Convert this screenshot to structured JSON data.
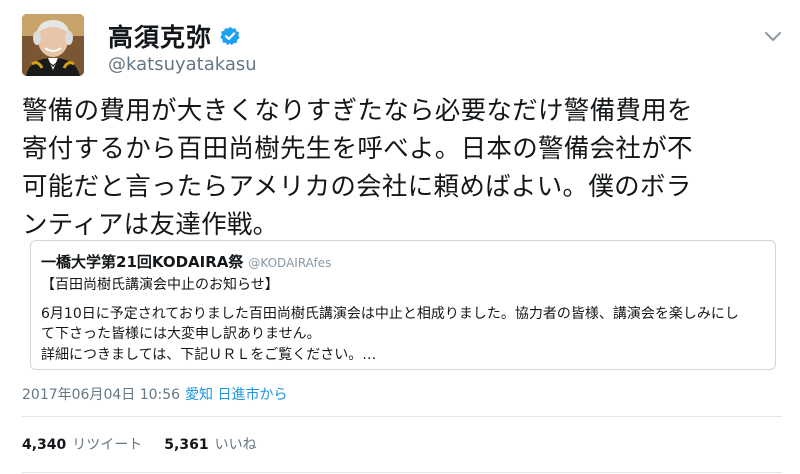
{
  "author": {
    "display_name": "高須克弥",
    "handle": "@katsuyatakasu",
    "verified": true
  },
  "tweet": {
    "lines": [
      "警備の費用が大きくなりすぎたなら必要なだけ警備費用を",
      "寄付するから百田尚樹先生を呼べよ。日本の警備会社が不",
      "可能だと言ったらアメリカの会社に頼めばよい。僕のボラ",
      "ンティアは友達作戦。"
    ]
  },
  "quoted": {
    "name": "一橋大学第21回KODAIRA祭",
    "handle": "@KODAIRAfes",
    "lines": [
      "【百田尚樹氏講演会中止のお知らせ】",
      "6月10日に予定されておりました百田尚樹氏講演会は中止と相成りました。協力者の皆様、講演会を楽しみにし",
      "て下さった皆様には大変申し訳ありません。",
      "詳細につきましては、下記ＵＲＬをご覧ください。…"
    ]
  },
  "meta": {
    "timestamp": "2017年06月04日 10:56",
    "place": "愛知 日進市から"
  },
  "stats": {
    "retweets": "4,340",
    "retweets_label": "リツイート",
    "likes": "5,361",
    "likes_label": "いいね"
  },
  "colors": {
    "verified": "#1da1f2",
    "link": "#1b95e0",
    "secondary_text": "#657786"
  },
  "icons": {
    "verified": "verified-badge-icon",
    "caret": "chevron-down-icon"
  }
}
